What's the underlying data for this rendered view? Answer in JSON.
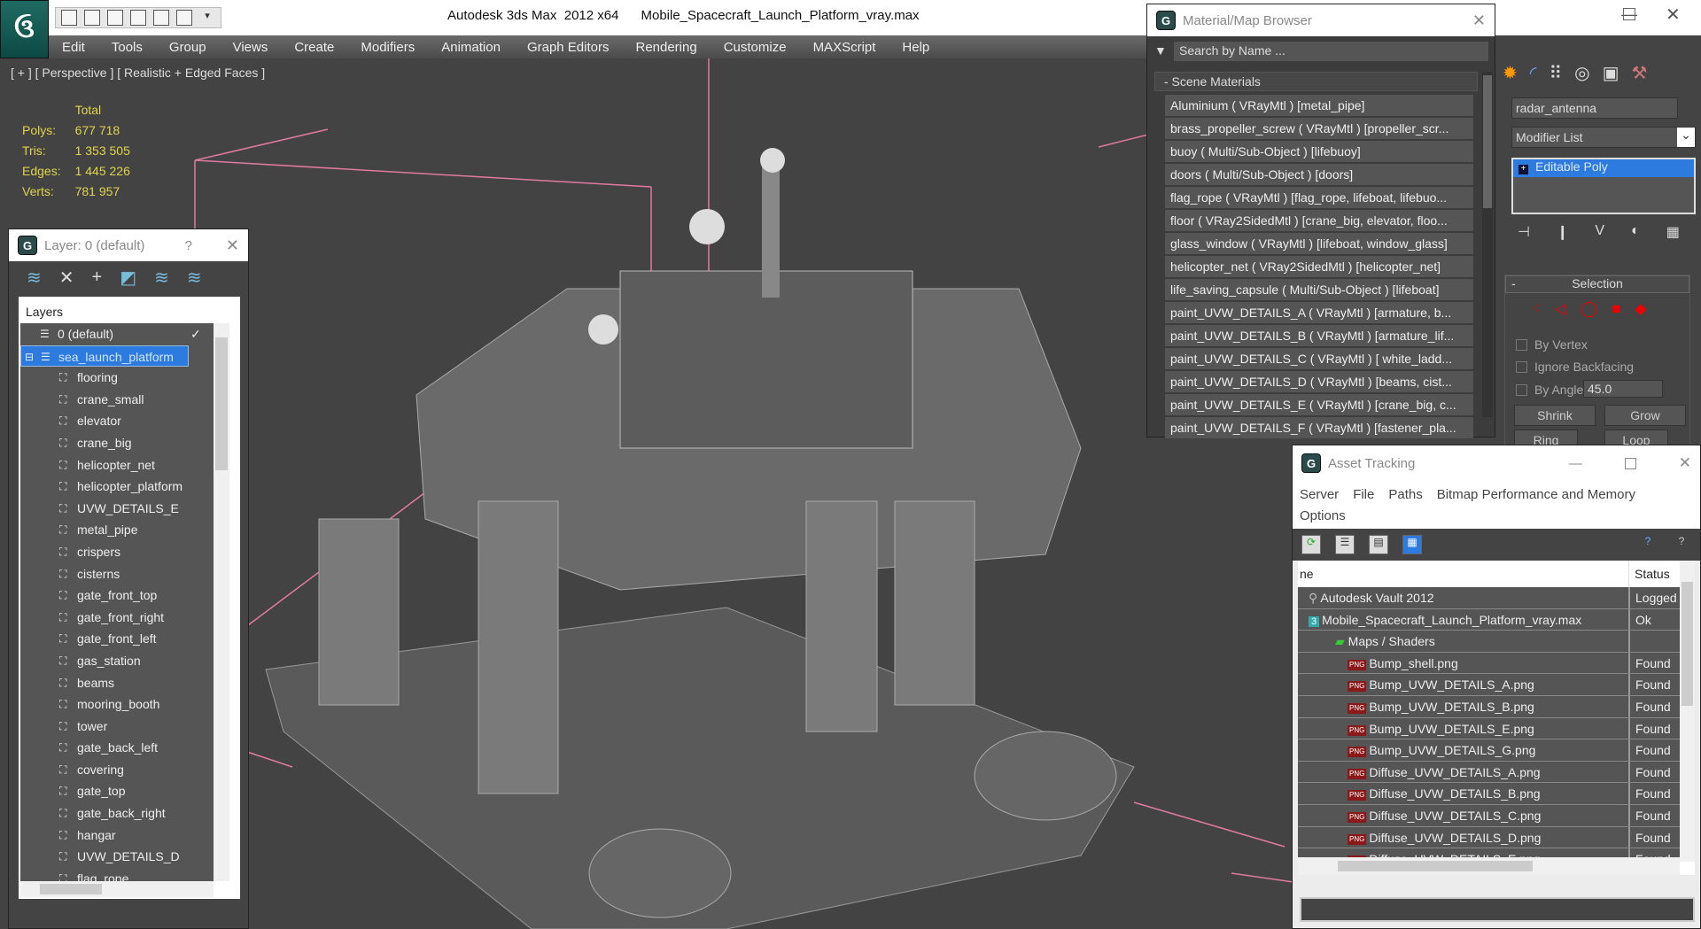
{
  "app": {
    "title": "Autodesk 3ds Max  2012 x64",
    "file": "Mobile_Spacecraft_Launch_Platform_vray.max",
    "logo": "3ds-max-logo"
  },
  "menu": [
    "Edit",
    "Tools",
    "Group",
    "Views",
    "Create",
    "Modifiers",
    "Animation",
    "Graph Editors",
    "Rendering",
    "Customize",
    "MAXScript",
    "Help"
  ],
  "viewport": {
    "label": "[ + ] [ Perspective ] [ Realistic + Edged Faces ]",
    "stats": {
      "header": "Total",
      "rows": [
        {
          "k": "Polys:",
          "v": "677 718"
        },
        {
          "k": "Tris:",
          "v": "1 353 505"
        },
        {
          "k": "Edges:",
          "v": "1 445 226"
        },
        {
          "k": "Verts:",
          "v": "781 957"
        }
      ]
    }
  },
  "layer_dialog": {
    "title": "Layer: 0 (default)",
    "help": "?",
    "header": "Layers",
    "top_layers": [
      {
        "name": "0 (default)",
        "check": "✓"
      },
      {
        "name": "sea_launch_platform",
        "selected": true
      }
    ],
    "objects": [
      "flooring",
      "crane_small",
      "elevator",
      "crane_big",
      "helicopter_net",
      "helicopter_platform",
      "UVW_DETAILS_E",
      "metal_pipe",
      "crispers",
      "cisterns",
      "gate_front_top",
      "gate_front_right",
      "gate_front_left",
      "gas_station",
      "beams",
      "mooring_booth",
      "tower",
      "gate_back_left",
      "covering",
      "gate_top",
      "gate_back_right",
      "hangar",
      "UVW_DETAILS_D",
      "flag_rope"
    ]
  },
  "material_browser": {
    "title": "Material/Map Browser",
    "search_placeholder": "Search by Name ...",
    "section": "- Scene Materials",
    "items": [
      "Aluminium  ( VRayMtl ) [metal_pipe]",
      "brass_propeller_screw ( VRayMtl ) [propeller_scr...",
      "buoy  ( Multi/Sub-Object ) [lifebuoy]",
      "doors  ( Multi/Sub-Object ) [doors]",
      "flag_rope ( VRayMtl ) [flag_rope, lifeboat, lifebuo...",
      "floor ( VRay2SidedMtl ) [crane_big, elevator, floo...",
      "glass_window  ( VRayMtl ) [lifeboat, window_glass]",
      "helicopter_net  ( VRay2SidedMtl ) [helicopter_net]",
      "life_saving_capsule ( Multi/Sub-Object ) [lifeboat]",
      "paint_UVW_DETAILS_A  ( VRayMtl )  [armature, b...",
      "paint_UVW_DETAILS_B  ( VRayMtl )  [armature_lif...",
      "paint_UVW_DETAILS_C  ( VRayMtl )  [ white_ladd...",
      "paint_UVW_DETAILS_D  ( VRayMtl )  [beams, cist...",
      "paint_UVW_DETAILS_E  ( VRayMtl )  [crane_big, c...",
      "paint_UVW_DETAILS_F  ( VRayMtl )  [fastener_pla..."
    ]
  },
  "command_panel": {
    "object_name": "radar_antenna",
    "modifier_list": "Modifier List",
    "stack_item": "Editable Poly",
    "rollout": "Selection",
    "by_vertex": "By Vertex",
    "ignore_backfacing": "Ignore Backfacing",
    "by_angle": "By Angle:",
    "angle_value": "45.0",
    "shrink": "Shrink",
    "grow": "Grow",
    "ring": "Ring",
    "loop": "Loop"
  },
  "asset_tracking": {
    "title": "Asset Tracking",
    "menu": [
      "Server",
      "File",
      "Paths",
      "Bitmap Performance and Memory",
      "Options"
    ],
    "col_name": "ne",
    "col_status": "Status",
    "rows": [
      {
        "name": "Autodesk Vault 2012",
        "status": "Logged",
        "level": 0,
        "icon": "vault-icon"
      },
      {
        "name": "Mobile_Spacecraft_Launch_Platform_vray.max",
        "status": "Ok",
        "level": 1,
        "icon": "max-file-icon"
      },
      {
        "name": "Maps / Shaders",
        "status": "",
        "level": 2,
        "icon": "maps-icon"
      },
      {
        "name": "Bump_shell.png",
        "status": "Found",
        "level": 3
      },
      {
        "name": "Bump_UVW_DETAILS_A.png",
        "status": "Found",
        "level": 3
      },
      {
        "name": "Bump_UVW_DETAILS_B.png",
        "status": "Found",
        "level": 3
      },
      {
        "name": "Bump_UVW_DETAILS_E.png",
        "status": "Found",
        "level": 3
      },
      {
        "name": "Bump_UVW_DETAILS_G.png",
        "status": "Found",
        "level": 3
      },
      {
        "name": "Diffuse_UVW_DETAILS_A.png",
        "status": "Found",
        "level": 3
      },
      {
        "name": "Diffuse_UVW_DETAILS_B.png",
        "status": "Found",
        "level": 3
      },
      {
        "name": "Diffuse_UVW_DETAILS_C.png",
        "status": "Found",
        "level": 3
      },
      {
        "name": "Diffuse_UVW_DETAILS_D.png",
        "status": "Found",
        "level": 3
      },
      {
        "name": "Diffuse_UVW_DETAILS_E.png",
        "status": "Found",
        "level": 3
      }
    ],
    "png_badge": "PNG"
  },
  "colors": {
    "selection": "#2e7be0",
    "stats": "#e3d34a",
    "grid": "#e07aa0"
  }
}
